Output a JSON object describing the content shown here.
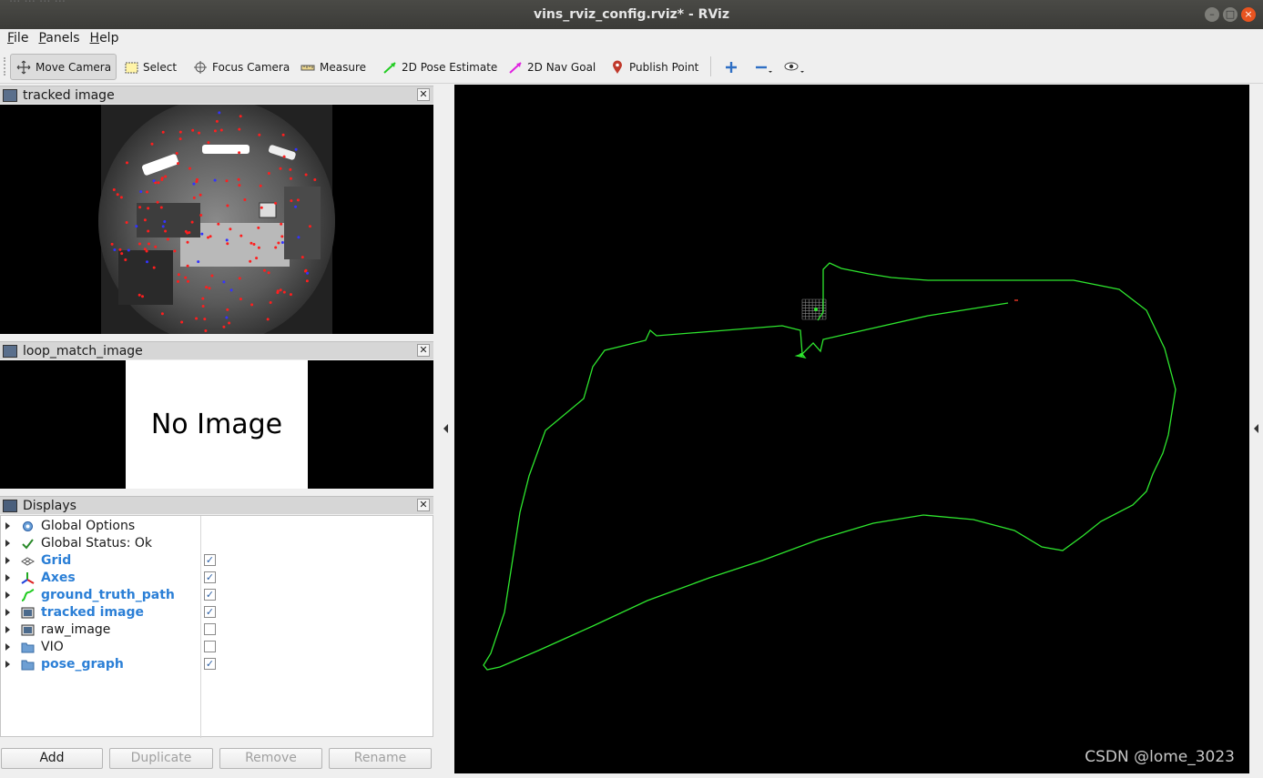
{
  "window": {
    "title": "vins_rviz_config.rviz* - RViz",
    "ghost_text": "... ... ... ..."
  },
  "menubar": {
    "items": [
      {
        "label": "File",
        "ul": "F",
        "rest": "ile"
      },
      {
        "label": "Panels",
        "ul": "P",
        "rest": "anels"
      },
      {
        "label": "Help",
        "ul": "H",
        "rest": "elp"
      }
    ]
  },
  "toolbar": {
    "tools": [
      {
        "label": "Move Camera",
        "icon": "move-camera-icon",
        "active": true
      },
      {
        "label": "Select",
        "icon": "select-icon"
      },
      {
        "label": "Focus Camera",
        "icon": "focus-camera-icon"
      },
      {
        "label": "Measure",
        "icon": "measure-icon"
      },
      {
        "label": "2D Pose Estimate",
        "icon": "pose-estimate-icon",
        "color": "#22cc22"
      },
      {
        "label": "2D Nav Goal",
        "icon": "nav-goal-icon",
        "color": "#e020e0"
      },
      {
        "label": "Publish Point",
        "icon": "publish-point-icon",
        "color": "#c0392b"
      }
    ],
    "extra_icons": [
      "add-tool-icon",
      "remove-tool-icon",
      "view-icon"
    ]
  },
  "panels": {
    "tracked": {
      "title": "tracked image"
    },
    "loop": {
      "title": "loop_match_image",
      "no_image_text": "No Image"
    },
    "displays": {
      "title": "Displays"
    }
  },
  "displays": [
    {
      "label": "Global Options",
      "icon": "gear-icon",
      "bold": false,
      "checkbox": null
    },
    {
      "label": "Global Status: Ok",
      "icon": "check-icon",
      "bold": false,
      "checkbox": null
    },
    {
      "label": "Grid",
      "icon": "grid-icon",
      "bold": true,
      "checkbox": true
    },
    {
      "label": "Axes",
      "icon": "axes-icon",
      "bold": true,
      "checkbox": true
    },
    {
      "label": "ground_truth_path",
      "icon": "path-icon",
      "bold": true,
      "checkbox": true
    },
    {
      "label": "tracked image",
      "icon": "image-icon",
      "bold": true,
      "checkbox": true
    },
    {
      "label": "raw_image",
      "icon": "image-icon",
      "bold": false,
      "checkbox": false
    },
    {
      "label": "VIO",
      "icon": "folder-icon",
      "bold": false,
      "checkbox": false
    },
    {
      "label": "pose_graph",
      "icon": "folder-icon",
      "bold": true,
      "checkbox": true
    }
  ],
  "buttons": {
    "add": "Add",
    "duplicate": "Duplicate",
    "remove": "Remove",
    "rename": "Rename"
  },
  "viewport": {
    "watermark": "CSDN @lome_3023",
    "path_color": "#2ee62e"
  }
}
